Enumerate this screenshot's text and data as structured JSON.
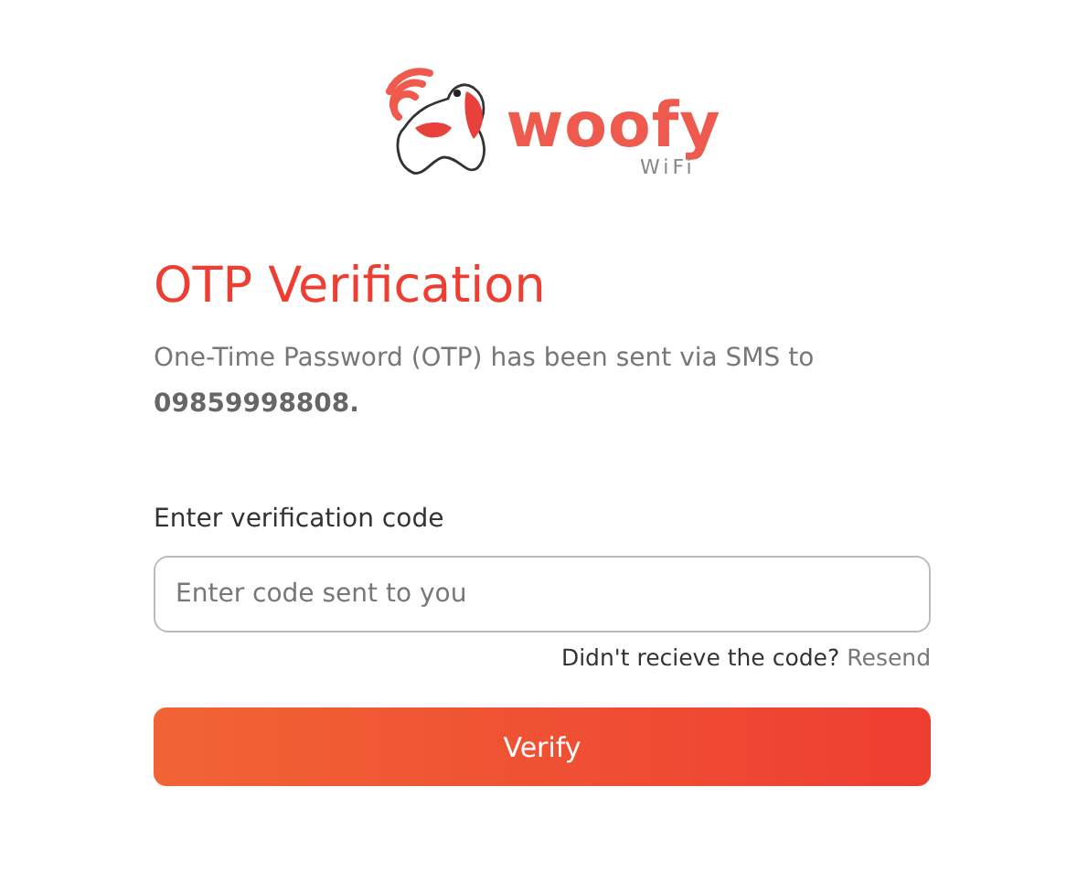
{
  "logo": {
    "name": "woofy",
    "tagline": "WiFi"
  },
  "title": "OTP Verification",
  "description": "One-Time Password (OTP) has been sent via SMS to **09859998808.**",
  "code_field": {
    "label": "Enter verification code",
    "placeholder": "Enter code sent to you"
  },
  "resend": {
    "prompt": "Didn't recieve the code?",
    "link": "Resend"
  },
  "verify_button": "Verify"
}
